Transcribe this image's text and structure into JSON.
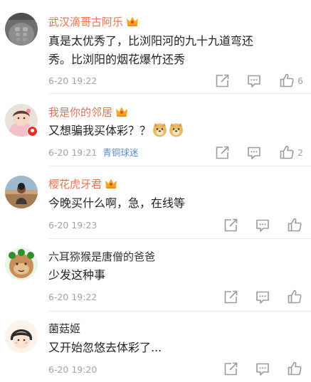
{
  "comments": [
    {
      "username": "武汉滴哥古阿乐",
      "vip": true,
      "lines": [
        "真是太优秀了，比浏阳河的九十九道弯还",
        "秀。比浏阳的烟花爆竹还秀"
      ],
      "time": "6-20 19:22",
      "badge": "",
      "likes": "6"
    },
    {
      "username": "我是你的邻居",
      "vip": true,
      "lines": [
        "又想骗我买体彩？？"
      ],
      "emojis": [
        "doge-emoji",
        "doge-emoji"
      ],
      "time": "6-20 19:21",
      "badge": "青铜球迷",
      "likes": "2"
    },
    {
      "username": "樱花虎牙君",
      "vip": true,
      "lines": [
        "今晚买什么啊，急，在线等"
      ],
      "time": "6-20 19:23",
      "badge": "",
      "likes": ""
    },
    {
      "username": "六耳猕猴是唐僧的爸爸",
      "vip": false,
      "lines": [
        "少发这种事"
      ],
      "time": "6-20 19:22",
      "badge": "",
      "likes": ""
    },
    {
      "username": "菌菇姬",
      "vip": false,
      "lines": [
        "又开始忽悠去体彩了..."
      ],
      "time": "6-20 19:20",
      "badge": "",
      "likes": ""
    }
  ],
  "icons": {
    "share": "share-icon",
    "reply": "comment-icon",
    "like": "thumbs-up-icon",
    "vip": "crown-icon"
  },
  "colors": {
    "vip_name": "#eb7350",
    "text": "#222222",
    "meta": "#a3a3a3",
    "badge": "#5b8bd0"
  }
}
